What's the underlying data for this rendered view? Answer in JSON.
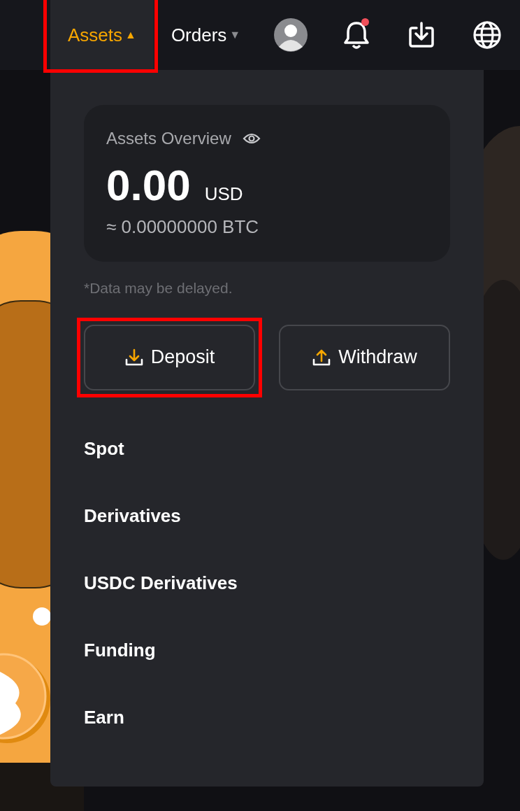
{
  "nav": {
    "items": [
      {
        "kind": "menu",
        "label": "Assets",
        "caret": "▲",
        "selected": true,
        "annotated": true
      },
      {
        "kind": "menu",
        "label": "Orders",
        "caret": "▼",
        "selected": false,
        "annotated": false
      },
      {
        "kind": "avatar"
      },
      {
        "kind": "bell",
        "unread": true
      },
      {
        "kind": "download"
      },
      {
        "kind": "globe"
      }
    ]
  },
  "dropdown": {
    "overview": {
      "title": "Assets Overview",
      "amount": "0.00",
      "currency": "USD",
      "btc": "≈ 0.00000000 BTC"
    },
    "note": "*Data may be delayed.",
    "actions": [
      {
        "kind": "deposit",
        "label": "Deposit",
        "annotated": true
      },
      {
        "kind": "withdraw",
        "label": "Withdraw",
        "annotated": false
      }
    ],
    "items": [
      {
        "label": "Spot"
      },
      {
        "label": "Derivatives"
      },
      {
        "label": "USDC Derivatives"
      },
      {
        "label": "Funding"
      },
      {
        "label": "Earn"
      }
    ]
  }
}
